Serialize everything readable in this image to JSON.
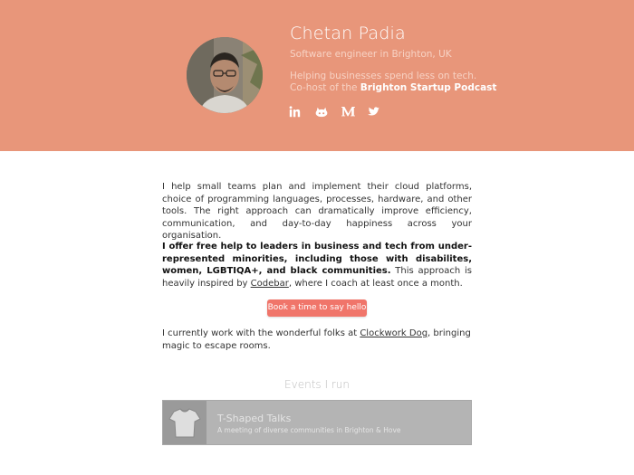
{
  "header": {
    "name": "Chetan Padia",
    "role": "Software engineer in Brighton, UK",
    "tagline": "Helping businesses spend less on tech.",
    "podcast_prefix": "Co-host of the ",
    "podcast_name": "Brighton Startup Podcast",
    "socials": [
      {
        "icon": "linkedin-icon"
      },
      {
        "icon": "github-icon"
      },
      {
        "icon": "medium-icon"
      },
      {
        "icon": "twitter-icon"
      }
    ]
  },
  "intro": {
    "paragraph1": "I help small teams plan and implement their cloud platforms, choice of programming languages, processes, hardware, and other tools. The right approach can dramatically improve efficiency, communication, and day-to-day happiness across your organisation.",
    "paragraph2_bold": "I offer free help to leaders in business and tech from under-represented minorities, including those with disabilites, women, LGBTIQA+, and black communities.",
    "paragraph2_rest": " This approach is heavily inspired by ",
    "codebar_link": "Codebar",
    "paragraph2_end": ", where I coach at least once a month."
  },
  "cta": {
    "label": "Book a time to say hello"
  },
  "work": {
    "prefix": "I currently work with the wonderful folks at ",
    "company_link": "Clockwork Dog",
    "suffix": ", bringing magic to escape rooms."
  },
  "events": {
    "heading": "Events I run",
    "items": [
      {
        "title": "T-Shaped Talks",
        "description": "A meeting of diverse communities in Brighton & Hove",
        "icon": "tshirt-icon"
      }
    ]
  },
  "colors": {
    "hero_bg": "#e8967a",
    "button_bg": "#f0756a",
    "event_card_bg": "#b4b4b4"
  }
}
